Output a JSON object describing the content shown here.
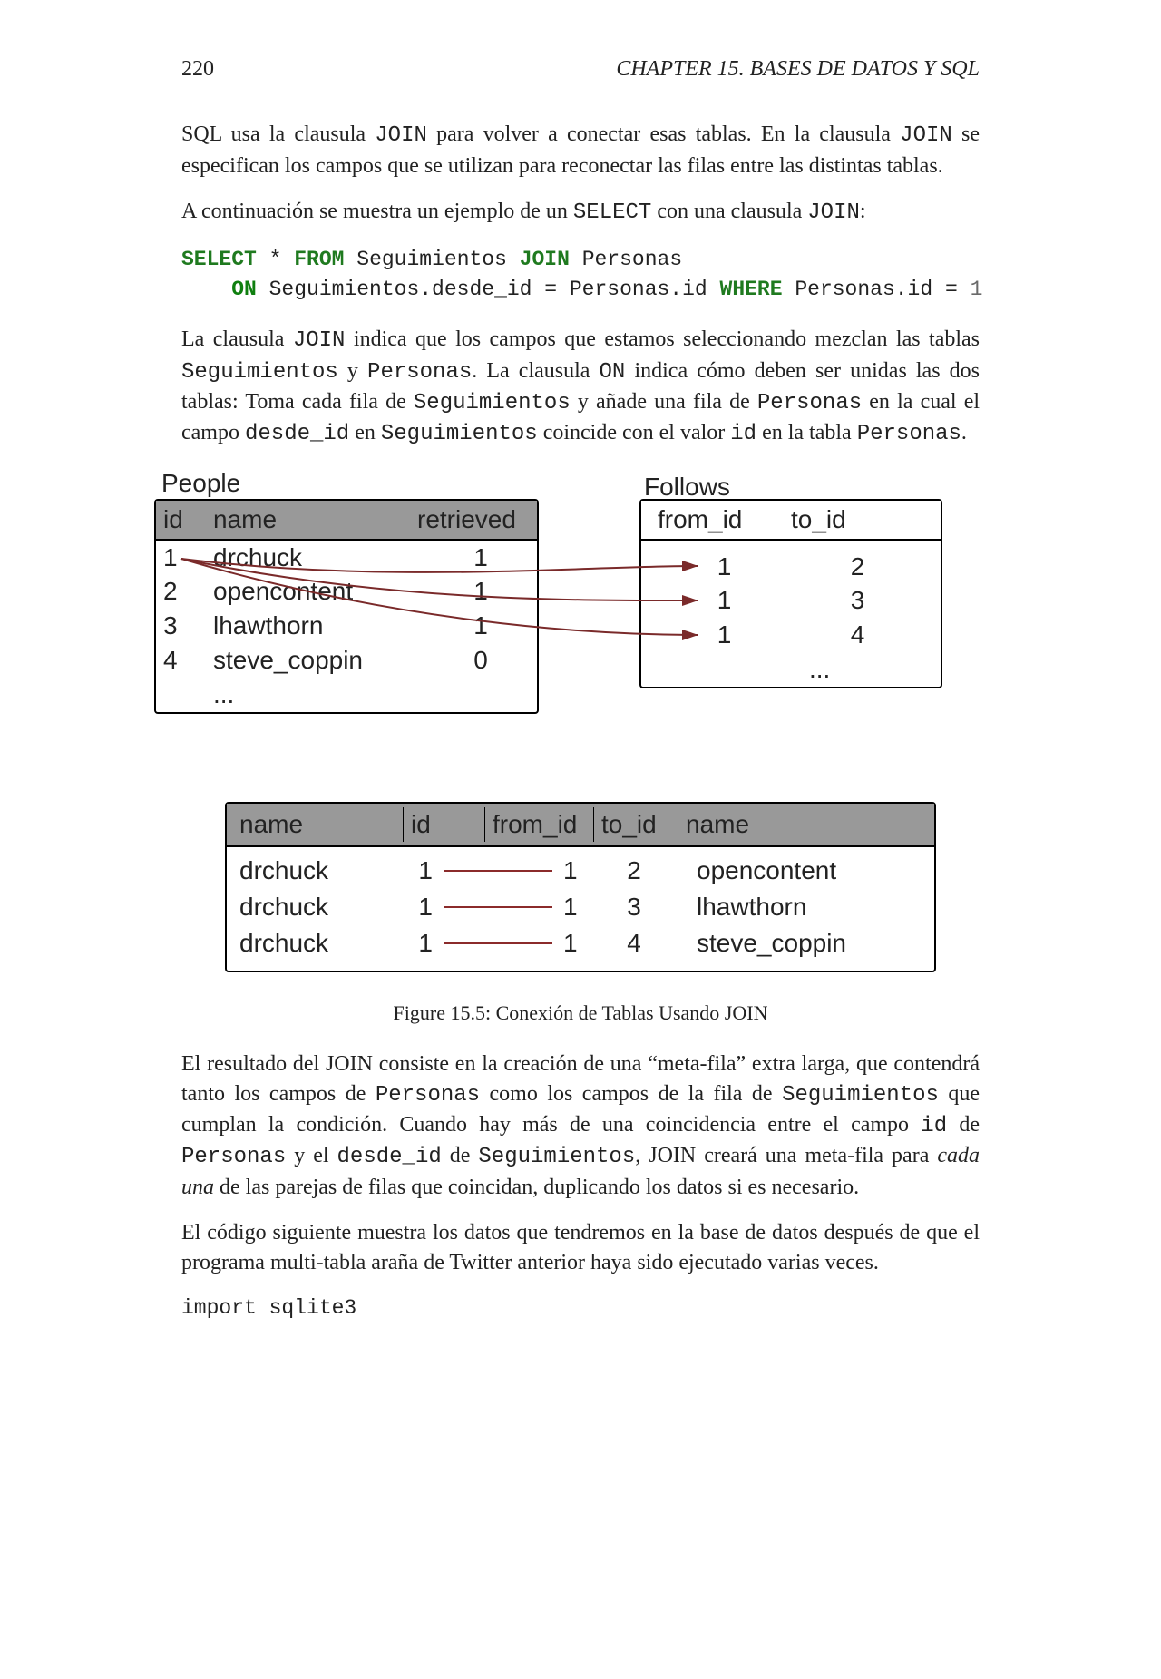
{
  "header": {
    "page_number": "220",
    "chapter_label": "CHAPTER 15.  BASES DE DATOS Y SQL"
  },
  "paragraphs": {
    "p1_a": "SQL usa la clausula ",
    "p1_join1": "JOIN",
    "p1_b": " para volver a conectar esas tablas. En la clausula ",
    "p1_join2": "JOIN",
    "p1_c": " se especifican los campos que se utilizan para reconectar las filas entre las distintas tablas.",
    "p2_a": "A continuación se muestra un ejemplo de un ",
    "p2_select": "SELECT",
    "p2_b": " con una clausula ",
    "p2_join": "JOIN",
    "p2_c": ":",
    "p3_a": "La clausula ",
    "p3_join": "JOIN",
    "p3_b": " indica que los campos que estamos seleccionando mezclan las tablas ",
    "p3_seg": "Seguimientos",
    "p3_c": " y ",
    "p3_per": "Personas",
    "p3_d": ". La clausula ",
    "p3_on": "ON",
    "p3_e": " indica cómo deben ser unidas las dos tablas: Toma cada fila de ",
    "p3_seg2": "Seguimientos",
    "p3_f": " y añade una fila de ",
    "p3_per2": "Personas",
    "p3_g": " en la cual el campo ",
    "p3_desde": "desde_id",
    "p3_h": " en ",
    "p3_seg3": "Seguimientos",
    "p3_i": " coincide con el valor ",
    "p3_id": "id",
    "p3_j": " en la tabla ",
    "p3_per3": "Personas",
    "p3_k": ".",
    "p4_a": "El resultado del JOIN consiste en la creación de una “meta-fila” extra larga, que contendrá tanto los campos de ",
    "p4_per": "Personas",
    "p4_b": " como los campos de la fila de ",
    "p4_seg": "Seguimientos",
    "p4_c": " que cumplan la condición. Cuando hay más de una coincidencia entre el campo ",
    "p4_id": "id",
    "p4_d": " de ",
    "p4_per2": "Personas",
    "p4_e": " y el ",
    "p4_desde": "desde_id",
    "p4_f": " de ",
    "p4_seg2": "Seguimientos",
    "p4_g": ", JOIN creará una meta-fila para ",
    "p4_cada": "cada una",
    "p4_h": " de las parejas de filas que coincidan, duplicando los datos si es necesario.",
    "p5": "El código siguiente muestra los datos que tendremos en la base de datos después de que el programa multi-tabla araña de Twitter anterior haya sido ejecutado varias veces."
  },
  "sql": {
    "select": "SELECT",
    "star": " * ",
    "from": "FROM",
    "seg": " Seguimientos ",
    "join": "JOIN",
    "per": " Personas",
    "on": "ON",
    "cond": " Seguimientos.desde_id = Personas.id ",
    "where": "WHERE",
    "cond2": " Personas.id = ",
    "one": "1"
  },
  "figure": {
    "people_title": "People",
    "follows_title": "Follows",
    "people_headers": {
      "id": "id",
      "name": "name",
      "retrieved": "retrieved"
    },
    "people_rows": [
      {
        "id": "1",
        "name": "drchuck",
        "retrieved": "1"
      },
      {
        "id": "2",
        "name": "opencontent",
        "retrieved": "1"
      },
      {
        "id": "3",
        "name": "lhawthorn",
        "retrieved": "1"
      },
      {
        "id": "4",
        "name": "steve_coppin",
        "retrieved": "0"
      }
    ],
    "people_ellipsis": "...",
    "follows_headers": {
      "from_id": "from_id",
      "to_id": "to_id"
    },
    "follows_rows": [
      {
        "from_id": "1",
        "to_id": "2"
      },
      {
        "from_id": "1",
        "to_id": "3"
      },
      {
        "from_id": "1",
        "to_id": "4"
      }
    ],
    "follows_ellipsis": "...",
    "join_headers": {
      "name1": "name",
      "id": "id",
      "from_id": "from_id",
      "to_id": "to_id",
      "name2": "name"
    },
    "join_rows": [
      {
        "name1": "drchuck",
        "id": "1",
        "from_id": "1",
        "to_id": "2",
        "name2": "opencontent"
      },
      {
        "name1": "drchuck",
        "id": "1",
        "from_id": "1",
        "to_id": "3",
        "name2": "lhawthorn"
      },
      {
        "name1": "drchuck",
        "id": "1",
        "from_id": "1",
        "to_id": "4",
        "name2": "steve_coppin"
      }
    ],
    "caption": "Figure 15.5: Conexión de Tablas Usando JOIN"
  },
  "code_tail": {
    "line1": "import sqlite3"
  }
}
